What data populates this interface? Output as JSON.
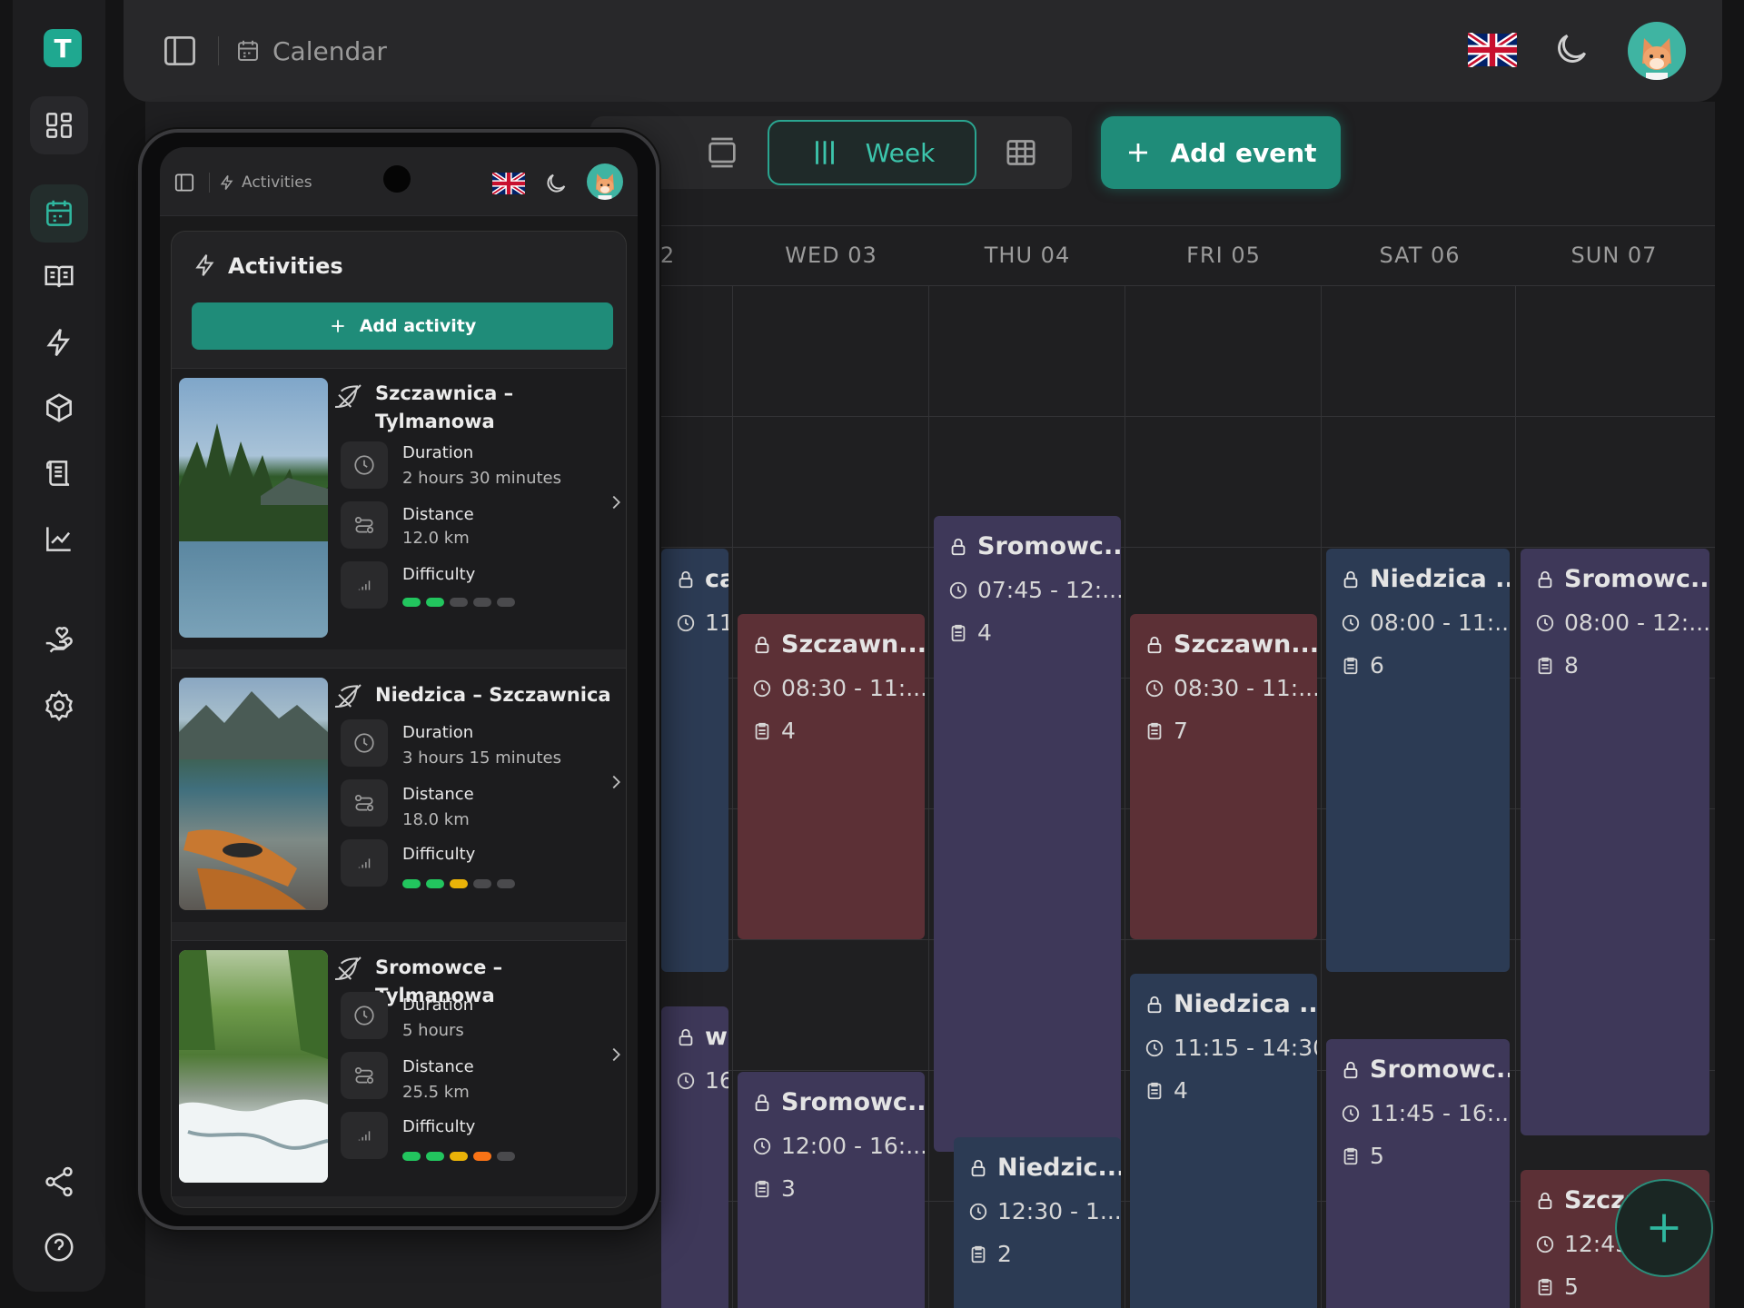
{
  "app": {
    "logo_letter": "T",
    "title": "Calendar"
  },
  "topbar": {
    "language": "English (UK)",
    "theme": "dark"
  },
  "calendar": {
    "view_label": "Week",
    "add_event_label": "Add event",
    "day_headers": [
      "2",
      "WED 03",
      "THU 04",
      "FRI 05",
      "SAT 06",
      "SUN 07"
    ],
    "events": [
      {
        "col": 0,
        "color": "blue",
        "title": "ca ...",
        "time": "11:...",
        "count": ""
      },
      {
        "col": 0,
        "color": "purple",
        "title": "wc...",
        "time": "16:...",
        "count": ""
      },
      {
        "col": 1,
        "color": "red",
        "title": "Szczawn...",
        "time": "08:30 - 11:...",
        "count": "4"
      },
      {
        "col": 1,
        "color": "purple",
        "title": "Sromowc...",
        "time": "12:00 - 16:...",
        "count": "3"
      },
      {
        "col": 2,
        "color": "purple",
        "title": "Sromowc...",
        "time": "07:45 - 12:...",
        "count": "4"
      },
      {
        "col": 2,
        "color": "blue",
        "title": "Niedzic...",
        "time": "12:30 - 1...",
        "count": "2"
      },
      {
        "col": 3,
        "color": "red",
        "title": "Szczawn...",
        "time": "08:30 - 11:...",
        "count": "7"
      },
      {
        "col": 3,
        "color": "blue",
        "title": "Niedzica ...",
        "time": "11:15 - 14:30",
        "count": "4"
      },
      {
        "col": 4,
        "color": "blue",
        "title": "Niedzica ...",
        "time": "08:00 - 11:...",
        "count": "6"
      },
      {
        "col": 4,
        "color": "purple",
        "title": "Sromowc...",
        "time": "11:45 - 16:...",
        "count": "5"
      },
      {
        "col": 5,
        "color": "purple",
        "title": "Sromowc...",
        "time": "08:00 - 12:...",
        "count": "8"
      },
      {
        "col": 5,
        "color": "red",
        "title": "Szcza",
        "time": "12:45",
        "count": "5"
      }
    ]
  },
  "phone": {
    "breadcrumb": "Activities",
    "panel_title": "Activities",
    "add_activity_label": "Add activity",
    "labels": {
      "duration": "Duration",
      "distance": "Distance",
      "difficulty": "Difficulty"
    },
    "activities": [
      {
        "name": "Szczawnica –\nTylmanowa",
        "duration": "2 hours 30 minutes",
        "distance": "12.0 km",
        "difficulty": 2
      },
      {
        "name": "Niedzica – Szczawnica",
        "duration": "3 hours 15 minutes",
        "distance": "18.0 km",
        "difficulty": 3
      },
      {
        "name": "Sromowce – Tylmanowa",
        "duration": "5 hours",
        "distance": "25.5 km",
        "difficulty": 4
      }
    ],
    "difficulty_max": 5,
    "difficulty_colors": [
      "#22c55e",
      "#22c55e",
      "#eab308",
      "#f97316",
      "#ef4444"
    ]
  },
  "colors": {
    "accent": "#1f8c79",
    "red_event": "#5c3036",
    "blue_event": "#2c3b54",
    "purple_event": "#3e3859"
  }
}
